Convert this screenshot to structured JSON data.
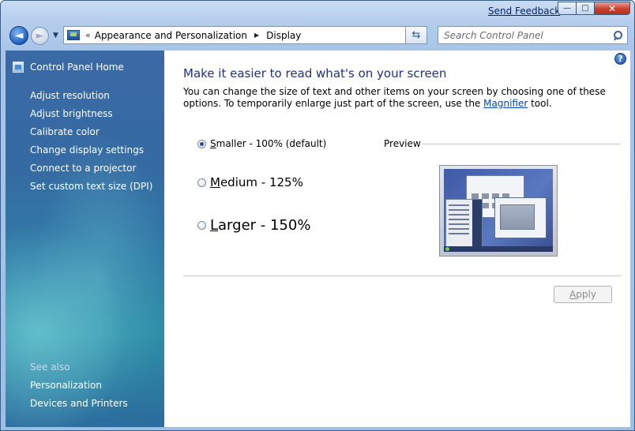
{
  "titlebar": {
    "feedback_label": "Send Feedback",
    "controls": {
      "minimize": "—",
      "maximize": "□",
      "close": "✕"
    }
  },
  "nav": {
    "back_icon": "◄",
    "forward_icon": "►",
    "breadcrumbs": [
      "Appearance and Personalization",
      "Display"
    ],
    "search_placeholder": "Search Control Panel"
  },
  "sidebar": {
    "home_label": "Control Panel Home",
    "links": [
      "Adjust resolution",
      "Adjust brightness",
      "Calibrate color",
      "Change display settings",
      "Connect to a projector",
      "Set custom text size (DPI)"
    ],
    "see_also_title": "See also",
    "see_also_links": [
      "Personalization",
      "Devices and Printers"
    ]
  },
  "main": {
    "help_icon": "?",
    "title": "Make it easier to read what's on your screen",
    "desc_before": "You can change the size of text and other items on your screen by choosing one of these options. To temporarily enlarge just part of the screen, use the ",
    "desc_link": "Magnifier",
    "desc_after": " tool.",
    "options": [
      {
        "mnemonic": "S",
        "rest": "maller - 100% (default)",
        "selected": true
      },
      {
        "mnemonic": "M",
        "rest": "edium - 125%",
        "selected": false
      },
      {
        "mnemonic": "L",
        "rest": "arger - 150%",
        "selected": false
      }
    ],
    "preview_label": "Preview",
    "apply_mnemonic": "A",
    "apply_rest": "pply"
  },
  "colors": {
    "title": "#1e3287",
    "link": "#0645ad",
    "sidebar_top": "#3b6aa7",
    "sidebar_glow": "#8ce6e6"
  }
}
